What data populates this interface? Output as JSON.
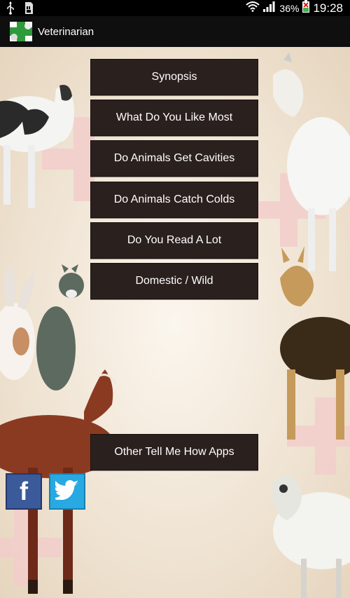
{
  "status_bar": {
    "time": "19:28",
    "battery_percent": "36%",
    "icons": [
      "usb-icon",
      "sd-card-icon",
      "wifi-icon",
      "signal-icon",
      "battery-icon"
    ]
  },
  "app_bar": {
    "title": "Veterinarian",
    "icon": "veterinarian-app-icon"
  },
  "menu": {
    "items": [
      {
        "label": "Synopsis"
      },
      {
        "label": "What Do You Like Most"
      },
      {
        "label": "Do Animals Get Cavities"
      },
      {
        "label": "Do Animals Catch Colds"
      },
      {
        "label": "Do You Read A Lot"
      },
      {
        "label": "Domestic / Wild"
      }
    ],
    "other_apps_label": "Other Tell Me How Apps"
  },
  "social": {
    "facebook_letter": "f",
    "icons": [
      "facebook-icon",
      "twitter-icon"
    ]
  },
  "colors": {
    "button_bg": "#2a201e",
    "button_text": "#ffffff",
    "facebook": "#3b5a9a",
    "twitter": "#29a9e1",
    "cross": "#f2c9c9"
  }
}
